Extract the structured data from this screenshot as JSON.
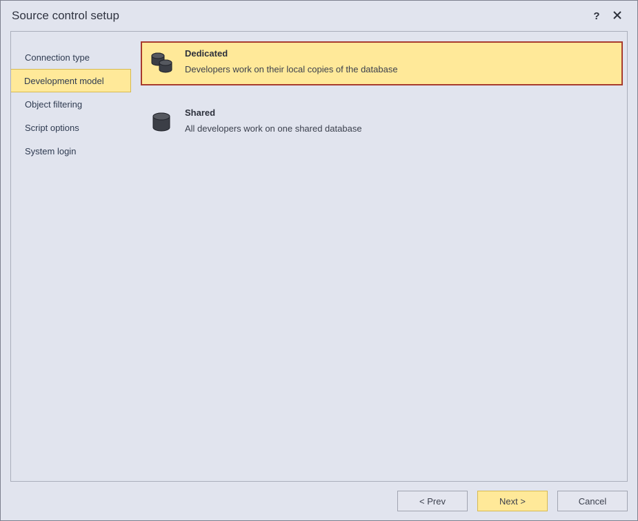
{
  "window": {
    "title": "Source control setup"
  },
  "sidebar": {
    "items": [
      {
        "label": "Connection type"
      },
      {
        "label": "Development model"
      },
      {
        "label": "Object filtering"
      },
      {
        "label": "Script options"
      },
      {
        "label": "System login"
      }
    ],
    "active_index": 1
  },
  "options": {
    "dedicated": {
      "name": "Dedicated",
      "desc": "Developers work on their local copies of the database"
    },
    "shared": {
      "name": "Shared",
      "desc": "All developers work on one shared database"
    },
    "selected": "dedicated"
  },
  "footer": {
    "prev": "< Prev",
    "next": "Next >",
    "cancel": "Cancel"
  }
}
